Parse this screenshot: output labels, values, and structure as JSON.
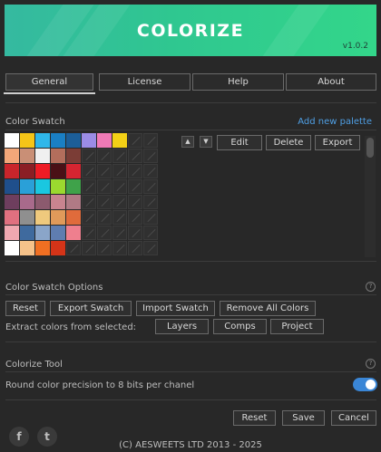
{
  "banner": {
    "title": "COLORIZE",
    "version": "v1.0.2"
  },
  "tabs": [
    {
      "label": "General",
      "active": true
    },
    {
      "label": "License",
      "active": false
    },
    {
      "label": "Help",
      "active": false
    },
    {
      "label": "About",
      "active": false
    }
  ],
  "swatch": {
    "title": "Color Swatch",
    "add_palette_link": "Add new palette",
    "up_icon": "chevron-up-icon",
    "down_icon": "chevron-down-icon",
    "edit_label": "Edit",
    "delete_label": "Delete",
    "export_label": "Export",
    "rows": [
      [
        "#ffffff",
        "#f5c518",
        "#2fb7ea",
        "#1a7fc4",
        "#1c5e98",
        "#9b8ce6",
        "#f07ab6",
        "#f4d116",
        null,
        null
      ],
      [
        "#f2a779",
        "#c98f76",
        "#f0f0f0",
        "#b36e5c",
        "#7b3d36",
        null,
        null,
        null,
        null,
        null
      ],
      [
        "#c9252b",
        "#8b1e24",
        "#ee1c25",
        "#4a1016",
        "#d62531",
        null,
        null,
        null,
        null,
        null
      ],
      [
        "#1f4f8b",
        "#2aa0d8",
        "#1ac7e0",
        "#9bd92f",
        "#3fa24a",
        null,
        null,
        null,
        null,
        null
      ],
      [
        "#6e3e5e",
        "#a86a8b",
        "#8c5a6e",
        "#c9848f",
        "#b07a85",
        null,
        null,
        null,
        null,
        null
      ],
      [
        "#e0707f",
        "#8f8f8f",
        "#efc97d",
        "#e09a5a",
        "#e06b3b",
        null,
        null,
        null,
        null,
        null
      ],
      [
        "#f0a8b0",
        "#3f6a9e",
        "#8aa5c9",
        "#5f7db0",
        "#ef7f8e",
        null,
        null,
        null,
        null,
        null
      ],
      [
        "#ffffff",
        "#f5c28a",
        "#f06f22",
        "#d43418",
        null,
        null,
        null,
        null,
        null,
        null
      ]
    ]
  },
  "options": {
    "title": "Color Swatch Options",
    "reset_label": "Reset",
    "export_swatch_label": "Export Swatch",
    "import_swatch_label": "Import Swatch",
    "remove_all_label": "Remove All Colors",
    "extract_label": "Extract colors from selected:",
    "layers_label": "Layers",
    "comps_label": "Comps",
    "project_label": "Project"
  },
  "tool": {
    "title": "Colorize Tool",
    "round_label": "Round color precision to 8 bits per chanel",
    "round_enabled": true
  },
  "footer": {
    "reset_label": "Reset",
    "save_label": "Save",
    "cancel_label": "Cancel",
    "facebook_icon": "f",
    "twitter_icon": "t",
    "copyright": "(C) AESWEETS LTD 2013 - 2025"
  },
  "colors": {
    "accent": "#3a86d6",
    "link": "#4f9fe4",
    "banner_start": "#35b9a0",
    "banner_end": "#33d68a"
  }
}
